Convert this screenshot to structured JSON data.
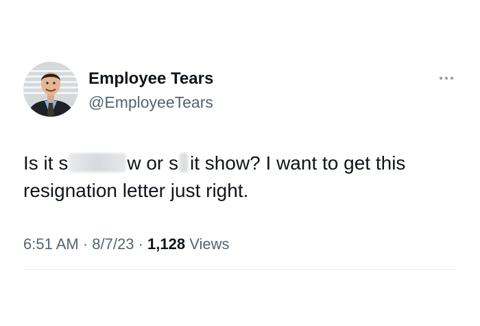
{
  "tweet": {
    "author": {
      "display_name": "Employee Tears",
      "handle": "@EmployeeTears",
      "avatar_icon": "profile-photo"
    },
    "more_icon": "more-options-icon",
    "text": {
      "segment_1": "Is it s",
      "segment_2": "w or s",
      "segment_3": "it show? I want to get this",
      "line_2": "resignation letter just right."
    },
    "meta": {
      "time": "6:51 AM",
      "separator": "·",
      "date": "8/7/23",
      "views_count": "1,128",
      "views_label": "Views"
    }
  },
  "colors": {
    "text_primary": "#0f1419",
    "text_secondary": "#536471",
    "divider": "#e6e9ec",
    "background": "#ffffff"
  }
}
